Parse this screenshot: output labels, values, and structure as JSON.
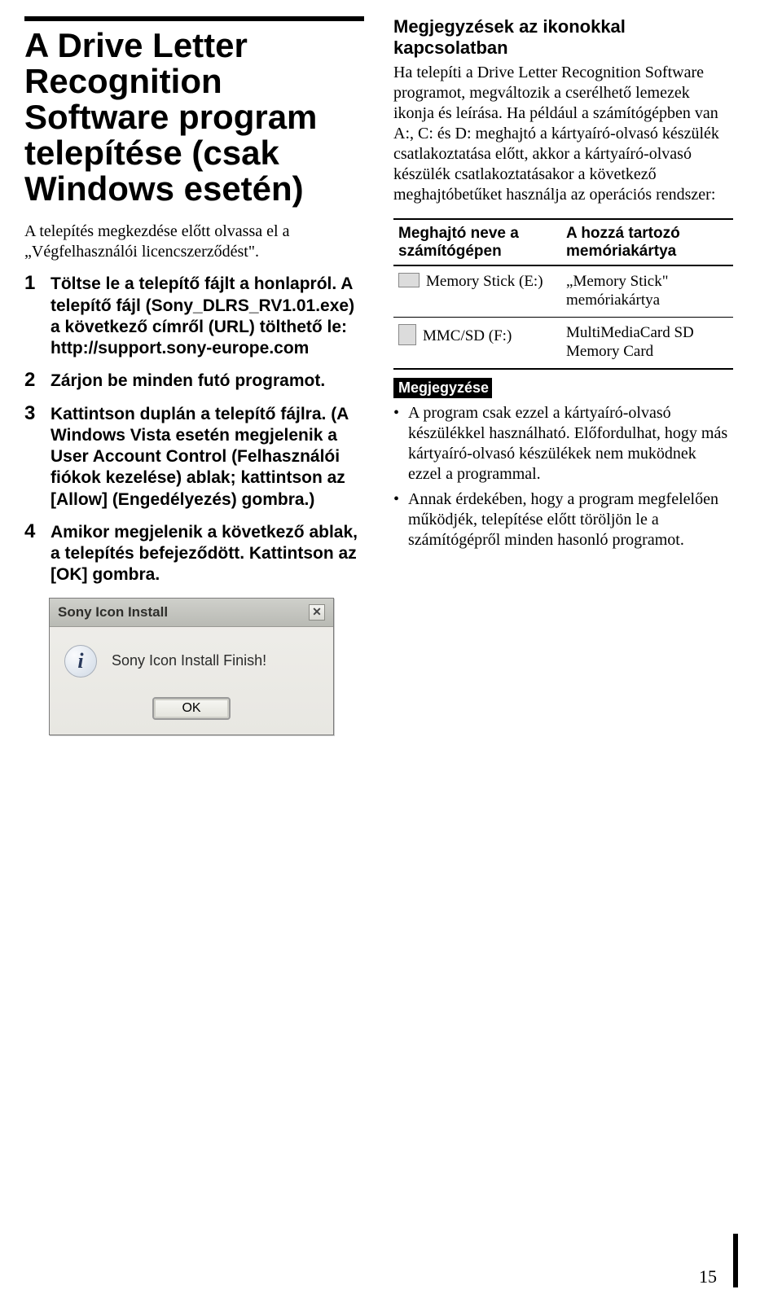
{
  "left": {
    "title": "A Drive Letter Recognition Software program telepítése (csak Windows esetén)",
    "intro": "A telepítés megkezdése előtt olvassa el a „Végfelhasználói licencszerződést\".",
    "steps": [
      {
        "num": "1",
        "text": "Töltse le a telepítő fájlt a honlapról. A telepítő fájl (Sony_DLRS_RV1.01.exe) a következő címről (URL) tölthető le:\nhttp://support.sony-europe.com"
      },
      {
        "num": "2",
        "text": "Zárjon be minden futó programot."
      },
      {
        "num": "3",
        "text": "Kattintson duplán a telepítő fájlra. (A Windows Vista esetén megjelenik a User Account Control (Felhasználói fiókok kezelése) ablak; kattintson az [Allow] (Engedélyezés) gombra.)"
      },
      {
        "num": "4",
        "text": "Amikor megjelenik a következő ablak, a telepítés befejeződött. Kattintson az [OK] gombra."
      }
    ],
    "dialog": {
      "title": "Sony Icon Install",
      "message": "Sony Icon Install Finish!",
      "ok": "OK"
    }
  },
  "right": {
    "heading": "Megjegyzések az ikonokkal kapcsolatban",
    "para": "Ha telepíti a Drive Letter Recognition Software programot, megváltozik a cserélhető lemezek ikonja és leírása. Ha például a számítógépben van A:, C: és D: meghajtó a kártyaíró-olvasó készülék csatlakoztatása előtt, akkor a kártyaíró-olvasó készülék csatlakoztatásakor a következő meghajtóbetűket használja az operációs rendszer:",
    "table": {
      "h1": "Meghajtó neve a számítógépen",
      "h2": "A hozzá tartozó memóriakártya",
      "rows": [
        {
          "drive": "Memory Stick (E:)",
          "card": "„Memory Stick\" memóriakártya"
        },
        {
          "drive": "MMC/SD (F:)",
          "card": "MultiMediaCard SD Memory Card"
        }
      ]
    },
    "noteLabel": "Megjegyzése",
    "bullets": [
      "A program csak ezzel a kártyaíró-olvasó készülékkel használható. Előfordulhat, hogy más kártyaíró-olvasó készülékek nem muködnek ezzel a programmal.",
      "Annak érdekében, hogy a program megfelelően működjék, telepítése előtt töröljön le a számítógépről minden hasonló programot."
    ]
  },
  "pageNumber": "15"
}
